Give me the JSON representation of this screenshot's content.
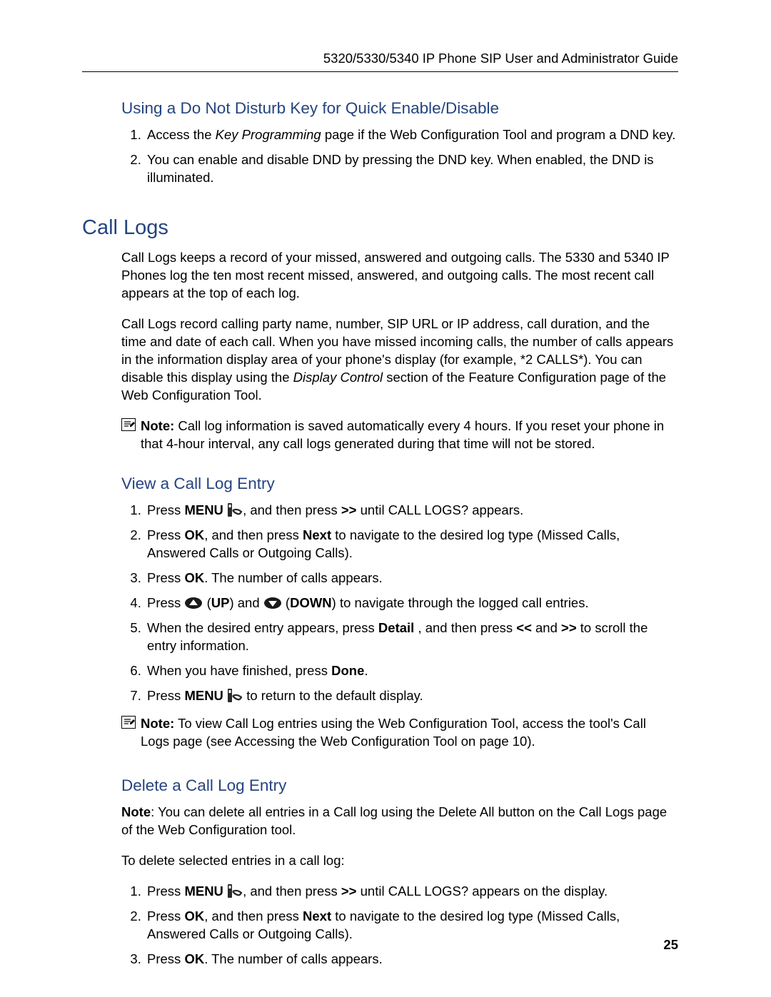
{
  "running_head": "5320/5330/5340 IP Phone SIP User and Administrator Guide",
  "page_number": "25",
  "s1": {
    "title": "Using a Do Not Disturb Key for Quick Enable/Disable",
    "li1_a": "Access the ",
    "li1_i": "Key Programming",
    "li1_b": " page if the Web Configuration Tool and program a DND key.",
    "li2": "You can enable and disable DND by pressing the DND key. When enabled, the DND is illuminated."
  },
  "h1": "Call Logs",
  "cl": {
    "p1": "Call Logs keeps a record of your missed, answered and outgoing calls. The 5330 and 5340 IP Phones log the ten most recent missed, answered, and outgoing calls. The most recent call appears at the top of each log.",
    "p2_a": "Call Logs record calling party name, number, SIP URL or IP address, call duration, and the time and date of each call. When you have missed incoming calls, the number of calls appears in the information display area of your phone's display (for example, *2 CALLS*). You can disable this display using the ",
    "p2_i": "Display Control",
    "p2_b": " section of the Feature Configuration page of the Web Configuration Tool.",
    "note_label": "Note:",
    "note_text": " Call log information is saved automatically every 4 hours. If you reset your phone in that 4-hour interval, any call logs generated during that time will not be stored."
  },
  "s2": {
    "title": "View a Call Log Entry",
    "li1_a": "Press ",
    "li1_b": "MENU",
    "li1_c": ",  and then press ",
    "li1_d": ">>",
    "li1_e": " until CALL LOGS? appears.",
    "li2_a": "Press ",
    "li2_b": "OK",
    "li2_c": ", and then press ",
    "li2_d": "Next",
    "li2_e": " to navigate to the desired log type (Missed Calls, Answered Calls or Outgoing Calls).",
    "li3_a": "Press ",
    "li3_b": "OK",
    "li3_c": ". The number of calls appears.",
    "li4_a": "Press ",
    "li4_b": " (",
    "li4_c": "UP",
    "li4_d": ") and ",
    "li4_e": " (",
    "li4_f": "DOWN",
    "li4_g": ") to navigate through the logged call entries.",
    "li5_a": "When the desired entry appears, press ",
    "li5_b": "Detail",
    "li5_c": " , and then press ",
    "li5_d": "<<",
    "li5_e": " and ",
    "li5_f": ">>",
    "li5_g": " to scroll the entry information.",
    "li6_a": "When you have finished, press ",
    "li6_b": "Done",
    "li6_c": ".",
    "li7_a": "Press ",
    "li7_b": "MENU",
    "li7_c": "  to return to the default display.",
    "note_label": "Note:",
    "note_text": "  To view Call Log entries using the Web Configuration Tool, access the tool's Call Logs page (see Accessing the Web Configuration Tool on page 10)."
  },
  "s3": {
    "title": "Delete a Call Log Entry",
    "p1_a": "Note",
    "p1_b": ": You can delete all entries in a Call log using the Delete All button on the Call Logs page of the Web Configuration tool.",
    "p2": "To delete selected entries in a call log:",
    "li1_a": "Press ",
    "li1_b": "MENU",
    "li1_c": ", and then press ",
    "li1_d": ">>",
    "li1_e": " until CALL LOGS? appears on the display.",
    "li2_a": "Press ",
    "li2_b": "OK",
    "li2_c": ", and then press ",
    "li2_d": "Next",
    "li2_e": " to navigate to the desired log type (Missed Calls, Answered Calls or Outgoing Calls).",
    "li3_a": "Press ",
    "li3_b": "OK",
    "li3_c": ". The number of calls appears."
  }
}
